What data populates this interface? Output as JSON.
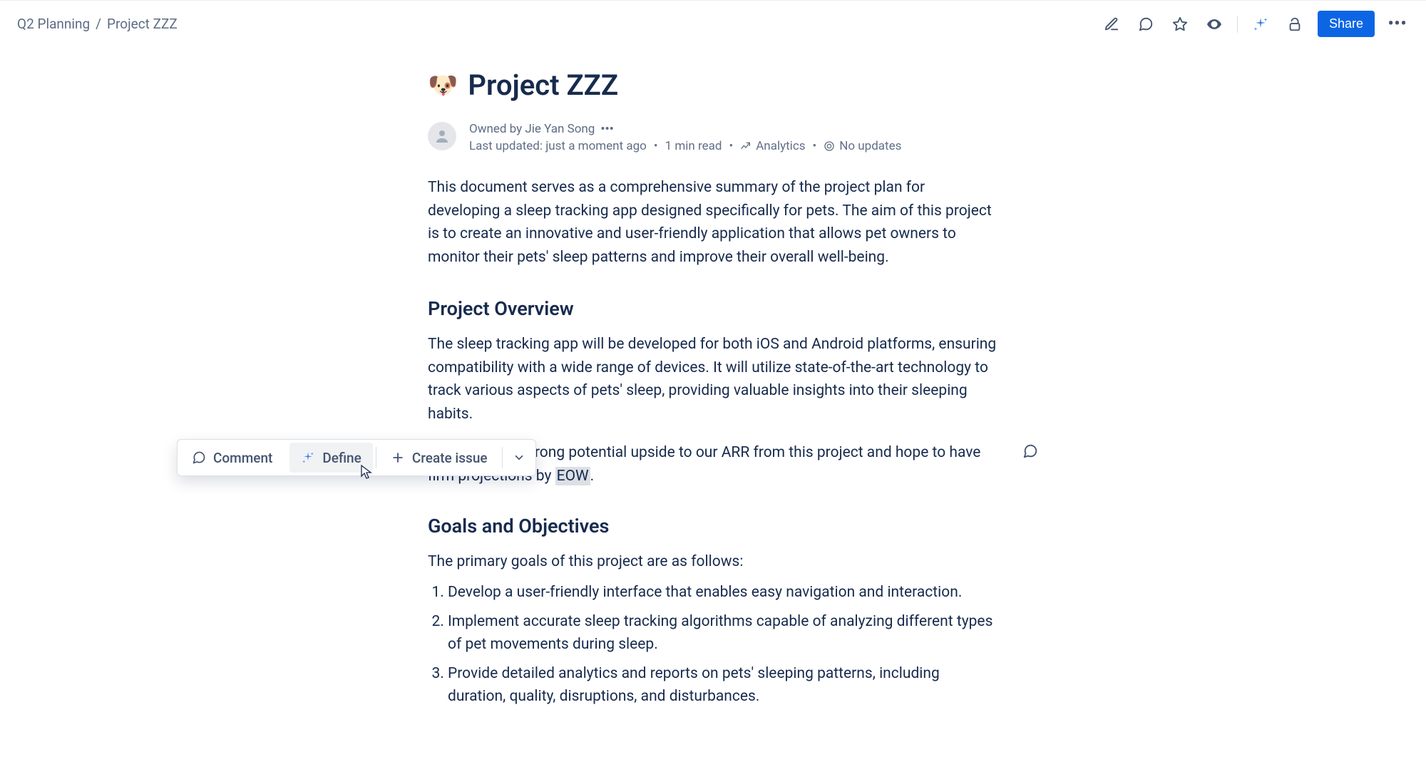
{
  "breadcrumb": {
    "parent": "Q2 Planning",
    "current": "Project ZZZ"
  },
  "actions": {
    "share_label": "Share"
  },
  "page": {
    "emoji": "🐶",
    "title": "Project ZZZ",
    "owner_prefix": "Owned by ",
    "owner": "Jie Yan Song",
    "last_updated": "Last updated: just a moment ago",
    "read_time": "1 min read",
    "analytics_label": "Analytics",
    "updates_label": "No updates"
  },
  "body": {
    "intro": "This document serves as a comprehensive summary of the project plan for developing a sleep tracking app designed specifically for pets. The aim of this project is to create an innovative and user-friendly application that allows pet owners to monitor their pets' sleep patterns and improve their overall well-being.",
    "overview_heading": "Project Overview",
    "overview_p1": "The sleep tracking app will be developed for both iOS and Android platforms, ensuring compatibility with a wide range of devices. It will utilize state-of-the-art technology to track various aspects of pets' sleep, providing valuable insights into their sleeping habits.",
    "overview_p2_a": "We anticipate strong potential upside to our ARR from this project and hope to have firm projections by ",
    "overview_p2_highlight": "EOW",
    "overview_p2_b": ".",
    "goals_heading": "Goals and Objectives",
    "goals_intro": "The primary goals of this project are as follows:",
    "goals": [
      "Develop a user-friendly interface that enables easy navigation and interaction.",
      "Implement accurate sleep tracking algorithms capable of analyzing different types of pet movements during sleep.",
      "Provide detailed analytics and reports on pets' sleeping patterns, including duration, quality, disruptions, and disturbances."
    ]
  },
  "toolbar": {
    "comment_label": "Comment",
    "define_label": "Define",
    "create_issue_label": "Create issue"
  }
}
